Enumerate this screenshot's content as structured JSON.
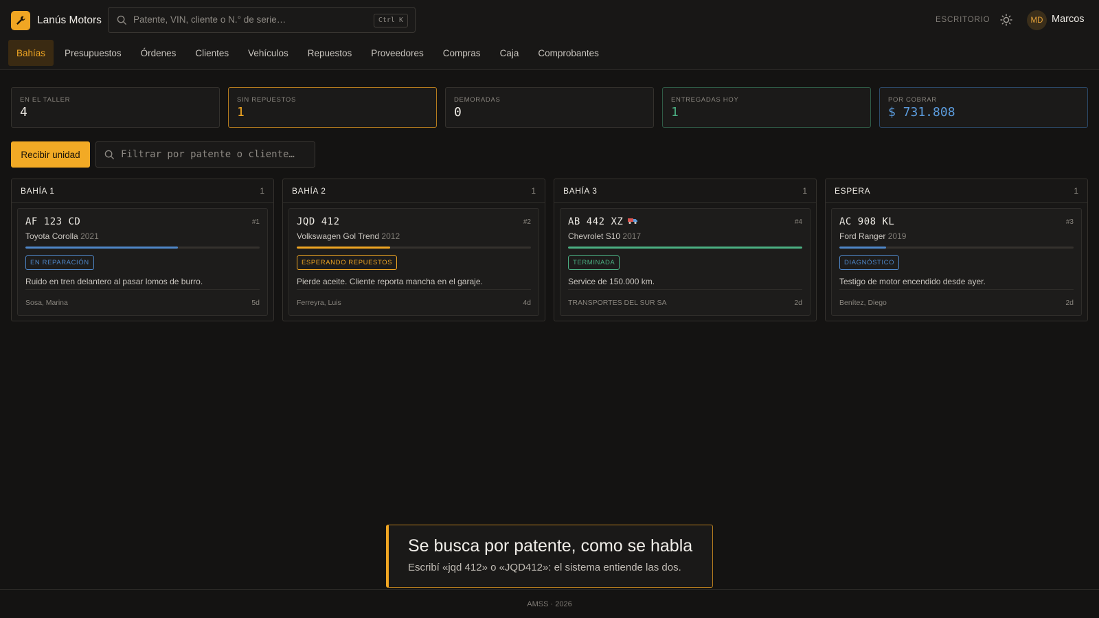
{
  "app": {
    "name": "Lanús Motors"
  },
  "search": {
    "placeholder": "Patente, VIN, cliente o N.° de serie…",
    "shortcut": "Ctrl K"
  },
  "header": {
    "mode_label": "ESCRITORIO",
    "user_initials": "MD",
    "user_name": "Marcos"
  },
  "nav": {
    "items": [
      "Bahías",
      "Presupuestos",
      "Órdenes",
      "Clientes",
      "Vehículos",
      "Repuestos",
      "Proveedores",
      "Compras",
      "Caja",
      "Comprobantes"
    ],
    "active": "Bahías"
  },
  "stats": [
    {
      "label": "EN EL TALLER",
      "value": "4"
    },
    {
      "label": "SIN REPUESTOS",
      "value": "1"
    },
    {
      "label": "DEMORADAS",
      "value": "0"
    },
    {
      "label": "ENTREGADAS HOY",
      "value": "1"
    },
    {
      "label": "POR COBRAR",
      "value": "$ 731.808"
    }
  ],
  "toolbar": {
    "receive_label": "Recibir unidad",
    "filter_placeholder": "Filtrar por patente o cliente…"
  },
  "bays": [
    {
      "title": "BAHÍA 1",
      "count": "1",
      "card": {
        "plate": "AF 123 CD",
        "number": "#1",
        "model": "Toyota Corolla",
        "year": "2021",
        "progress": 0.65,
        "status": "EN REPARACIÓN",
        "status_color": "#4f87c9",
        "note": "Ruido en tren delantero al pasar lomos de burro.",
        "customer": "Sosa, Marina",
        "age": "5d"
      }
    },
    {
      "title": "BAHÍA 2",
      "count": "1",
      "card": {
        "plate": "JQD 412",
        "number": "#2",
        "model": "Volkswagen Gol Trend",
        "year": "2012",
        "progress": 0.4,
        "status": "ESPERANDO REPUESTOS",
        "status_color": "#f0a623",
        "note": "Pierde aceite. Cliente reporta mancha en el garaje.",
        "customer": "Ferreyra, Luis",
        "age": "4d"
      }
    },
    {
      "title": "BAHÍA 3",
      "count": "1",
      "card": {
        "plate": "AB 442 XZ",
        "plate_icon": "truck-icon",
        "number": "#4",
        "model": "Chevrolet S10",
        "year": "2017",
        "progress": 1.0,
        "status": "TERMINADA",
        "status_color": "#4bb083",
        "note": "Service de 150.000 km.",
        "customer": "TRANSPORTES DEL SUR SA",
        "age": "2d"
      }
    },
    {
      "title": "ESPERA",
      "count": "1",
      "card": {
        "plate": "AC 908 KL",
        "number": "#3",
        "model": "Ford Ranger",
        "year": "2019",
        "progress": 0.2,
        "status": "DIAGNÓSTICO",
        "status_color": "#4f87c9",
        "note": "Testigo de motor encendido desde ayer.",
        "customer": "Benítez, Diego",
        "age": "2d"
      }
    }
  ],
  "toast": {
    "title": "Se busca por patente, como se habla",
    "body": "Escribí «jqd 412» o «JQD412»: el sistema entiende las dos."
  },
  "footer": {
    "text": "AMSS · 2026"
  },
  "colors": {
    "accent": "#f0a623",
    "ok": "#4bb083",
    "info": "#5b9bdc"
  }
}
